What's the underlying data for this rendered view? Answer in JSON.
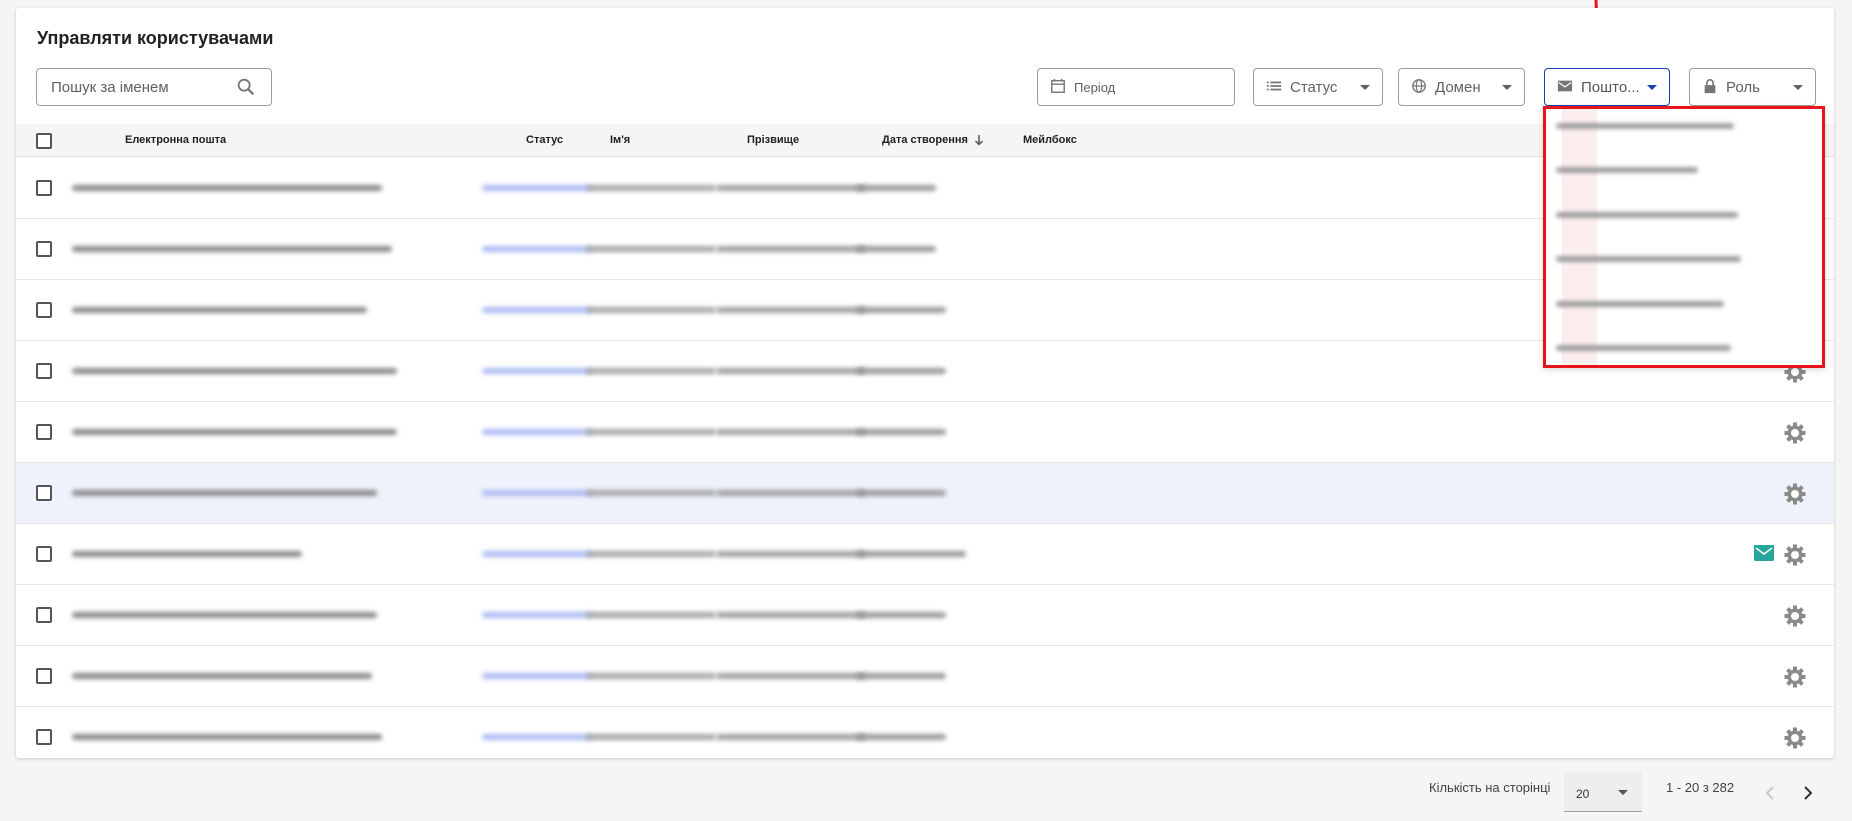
{
  "title": "Управляти користувачами",
  "search": {
    "placeholder": "Пошук за іменем"
  },
  "filters": {
    "period": "Період",
    "status": "Статус",
    "domain": "Домен",
    "mailbox": "Пошто...",
    "role": "Роль"
  },
  "table": {
    "headers": {
      "email": "Електронна пошта",
      "status": "Статус",
      "first_name": "Ім'я",
      "last_name": "Прізвище",
      "created": "Дата створення",
      "mailbox": "Мейлбокс"
    },
    "row_count_visible": 10
  },
  "footer": {
    "per_page_label": "Кількість на сторінці",
    "per_page_value": "20",
    "range": "1 - 20 з 282"
  },
  "colors": {
    "accent": "#1a3fb0",
    "highlight": "#e8141c",
    "mail_ok": "#26a69a"
  }
}
